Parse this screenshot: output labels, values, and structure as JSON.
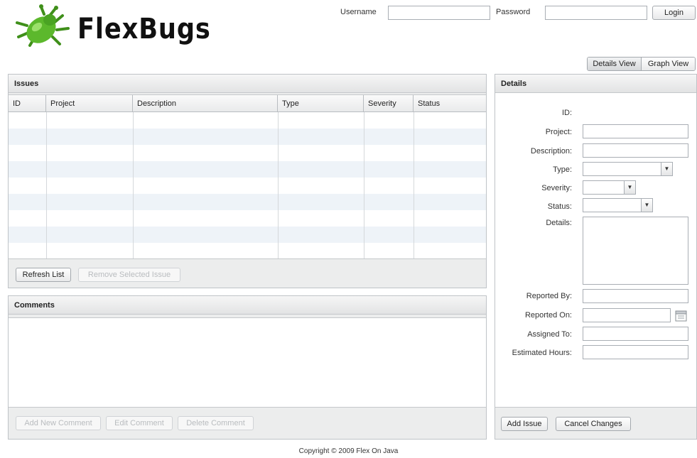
{
  "app": {
    "name": "FlexBugs",
    "copyright": "Copyright © 2009 Flex On Java"
  },
  "login": {
    "username_label": "Username",
    "username_value": "",
    "password_label": "Password",
    "password_value": "",
    "login_button": "Login"
  },
  "views": {
    "details_view": "Details View",
    "graph_view": "Graph View",
    "active": "details_view"
  },
  "issues": {
    "title": "Issues",
    "columns": [
      "ID",
      "Project",
      "Description",
      "Type",
      "Severity",
      "Status"
    ],
    "rows": [],
    "refresh_button": "Refresh List",
    "remove_button": "Remove Selected Issue"
  },
  "comments": {
    "title": "Comments",
    "add_button": "Add New Comment",
    "edit_button": "Edit Comment",
    "delete_button": "Delete Comment"
  },
  "details": {
    "title": "Details",
    "fields": {
      "id": {
        "label": "ID:",
        "value": ""
      },
      "project": {
        "label": "Project:",
        "value": ""
      },
      "description": {
        "label": "Description:",
        "value": ""
      },
      "type": {
        "label": "Type:",
        "value": ""
      },
      "severity": {
        "label": "Severity:",
        "value": ""
      },
      "status": {
        "label": "Status:",
        "value": ""
      },
      "details": {
        "label": "Details:",
        "value": ""
      },
      "reported_by": {
        "label": "Reported By:",
        "value": ""
      },
      "reported_on": {
        "label": "Reported On:",
        "value": ""
      },
      "assigned_to": {
        "label": "Assigned To:",
        "value": ""
      },
      "estimated_hours": {
        "label": "Estimated Hours:",
        "value": ""
      }
    },
    "add_button": "Add Issue",
    "cancel_button": "Cancel Changes"
  },
  "icons": {
    "logo": "bug-icon",
    "date_picker": "calendar-icon",
    "combo": "chevron-down-icon"
  },
  "colors": {
    "logo_green": "#5cb82c",
    "panel_bg": "#eceded",
    "row_alt": "#eef3f8"
  }
}
